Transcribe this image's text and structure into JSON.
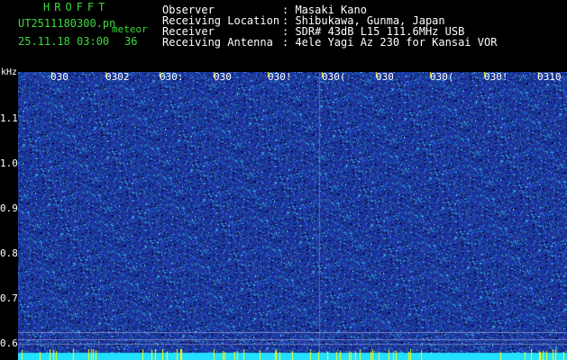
{
  "header": {
    "title": "HROFFT",
    "filename": "UT2511180300.pn",
    "meteor_label": "meteor",
    "datetime": "25.11.18 03:00",
    "meteor_count": "36"
  },
  "info": [
    {
      "label": "Observer",
      "value": ": Masaki Kano"
    },
    {
      "label": "Receiving Location",
      "value": ": Shibukawa, Gunma, Japan"
    },
    {
      "label": "Receiver",
      "value": ": SDR# 43dB L15 111.6MHz USB"
    },
    {
      "label": "Receiving Antenna",
      "value": ": 4ele Yagi Az 230 for Kansai VOR"
    }
  ],
  "axis": {
    "y_unit": "kHz",
    "y_ticks": [
      "1.1",
      "1.0",
      "0.9",
      "0.8",
      "0.7",
      "0.6"
    ],
    "x_ticks": [
      "030",
      "0302",
      "030:",
      "030",
      "030!",
      "030(",
      "030",
      "030(",
      "030!",
      "0310"
    ]
  },
  "colors": {
    "background": "#000000",
    "header_green": "#3bdc3b",
    "spectrum_blue": "#1c2a9a",
    "baseline_cyan": "#22e0ff",
    "tick_yellow": "#ffff00"
  }
}
